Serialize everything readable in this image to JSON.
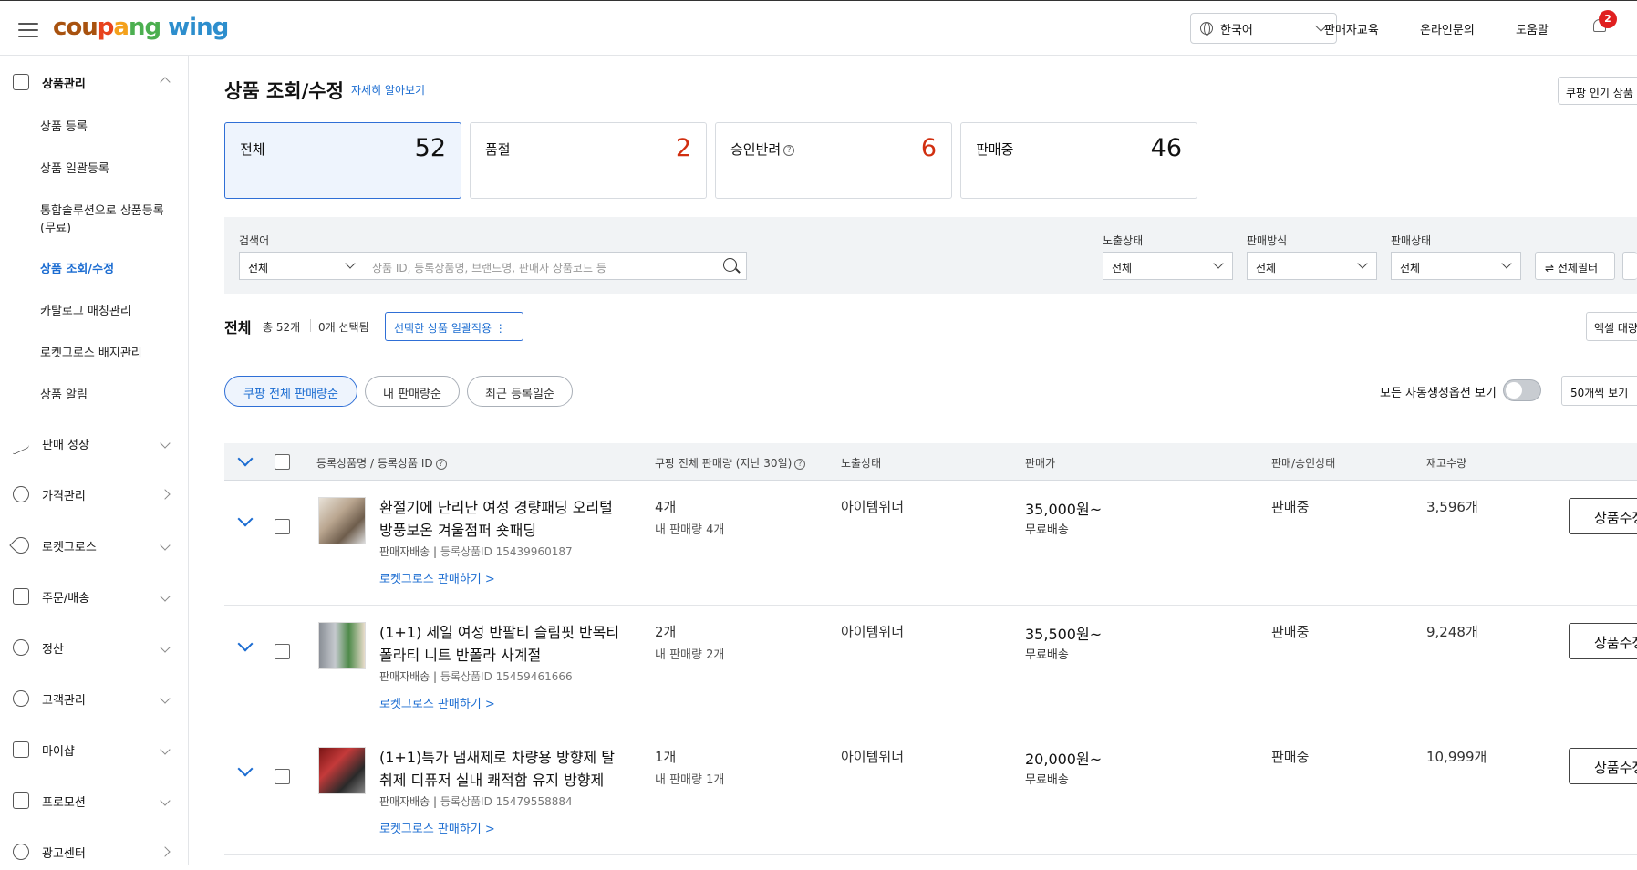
{
  "header": {
    "logo": {
      "part1": "cou",
      "part2": "p",
      "part3": "a",
      "part4": "ng",
      "part5": " wing"
    },
    "language": "한국어",
    "links": [
      "판매자교육",
      "온라인문의",
      "도움말"
    ],
    "notification_count": "2"
  },
  "sidebar": {
    "groups": [
      {
        "label": "상품관리",
        "icon": "box-icon",
        "state": "expanded"
      },
      {
        "label": "판매 성장",
        "icon": "trend-icon",
        "state": "collapsed"
      },
      {
        "label": "가격관리",
        "icon": "price-tag-icon",
        "state": "link"
      },
      {
        "label": "로켓그로스",
        "icon": "rocket-icon",
        "state": "collapsed"
      },
      {
        "label": "주문/배송",
        "icon": "truck-icon",
        "state": "collapsed"
      },
      {
        "label": "정산",
        "icon": "won-coin-icon",
        "state": "collapsed"
      },
      {
        "label": "고객관리",
        "icon": "smile-icon",
        "state": "collapsed"
      },
      {
        "label": "마이샵",
        "icon": "shop-icon",
        "state": "collapsed"
      },
      {
        "label": "프로모션",
        "icon": "coupon-icon",
        "state": "collapsed"
      },
      {
        "label": "광고센터",
        "icon": "ad-icon",
        "state": "link"
      }
    ],
    "items": [
      {
        "label": "상품 등록"
      },
      {
        "label": "상품 일괄등록"
      },
      {
        "label": "통합솔루션으로 상품등록\n(무료)"
      },
      {
        "label": "상품 조회/수정"
      },
      {
        "label": "카탈로그 매칭관리"
      },
      {
        "label": "로켓그로스 배지관리"
      },
      {
        "label": "상품 알림"
      }
    ]
  },
  "page": {
    "title": "상품 조회/수정",
    "learn_more": "자세히 알아보기",
    "popular_button": "쿠팡 인기 상품"
  },
  "stats": [
    {
      "label": "전체",
      "value": "52"
    },
    {
      "label": "품절",
      "value": "2"
    },
    {
      "label": "승인반려",
      "value": "6"
    },
    {
      "label": "판매중",
      "value": "46"
    }
  ],
  "search": {
    "label": "검색어",
    "scope": "전체",
    "placeholder": "상품 ID, 등록상품명, 브랜드명, 판매자 상품코드 등",
    "exposure_label": "노출상태",
    "exposure_value": "전체",
    "method_label": "판매방식",
    "method_value": "전체",
    "sale_label": "판매상태",
    "sale_value": "전체",
    "filter_button": "전체필터"
  },
  "list": {
    "heading": "전체",
    "total": "총 52개",
    "selected": "0개 선택됨",
    "bulk_button": "선택한 상품 일괄적용 ⋮",
    "excel_button": "엑셀 대량"
  },
  "sort": {
    "options": [
      "쿠팡 전체 판매량순",
      "내 판매량순",
      "최근 등록일순"
    ],
    "auto_option_label": "모든 자동생성옵션 보기",
    "per_page": "50개씩 보기"
  },
  "table": {
    "headers": [
      "등록상품명 / 등록상품 ID",
      "쿠팡 전체 판매량 (지난 30일)",
      "노출상태",
      "판매가",
      "판매/승인상태",
      "재고수량"
    ],
    "rows": [
      {
        "name": "환절기에 난리난 여성 경량패딩 오리털 방풍보온 겨울점퍼 숏패딩",
        "shipping_type": "판매자배송",
        "product_id": "등록상품ID 15439960187",
        "rocket_link": "로켓그로스 판매하기 >",
        "total_sales": "4개",
        "my_sales": "내 판매량 4개",
        "exposure": "아이템위너",
        "price": "35,000원~",
        "delivery": "무료배송",
        "status": "판매중",
        "stock": "3,596개",
        "edit": "상품수정"
      },
      {
        "name": "(1+1) 세일 여성 반팔티 슬림핏 반목티 폴라티 니트 반폴라 사계절",
        "shipping_type": "판매자배송",
        "product_id": "등록상품ID 15459461666",
        "rocket_link": "로켓그로스 판매하기 >",
        "total_sales": "2개",
        "my_sales": "내 판매량 2개",
        "exposure": "아이템위너",
        "price": "35,500원~",
        "delivery": "무료배송",
        "status": "판매중",
        "stock": "9,248개",
        "edit": "상품수정"
      },
      {
        "name": "(1+1)특가 냄새제로 차량용 방향제 탈취제 디퓨저 실내 쾌적함 유지 방향제",
        "shipping_type": "판매자배송",
        "product_id": "등록상품ID 15479558884",
        "rocket_link": "로켓그로스 판매하기 >",
        "total_sales": "1개",
        "my_sales": "내 판매량 1개",
        "exposure": "아이템위너",
        "price": "20,000원~",
        "delivery": "무료배송",
        "status": "판매중",
        "stock": "10,999개",
        "edit": "상품수정"
      }
    ]
  },
  "colors": {
    "accent": "#1b6cd1",
    "alert": "#d12f10",
    "panel": "#f1f3f5"
  }
}
